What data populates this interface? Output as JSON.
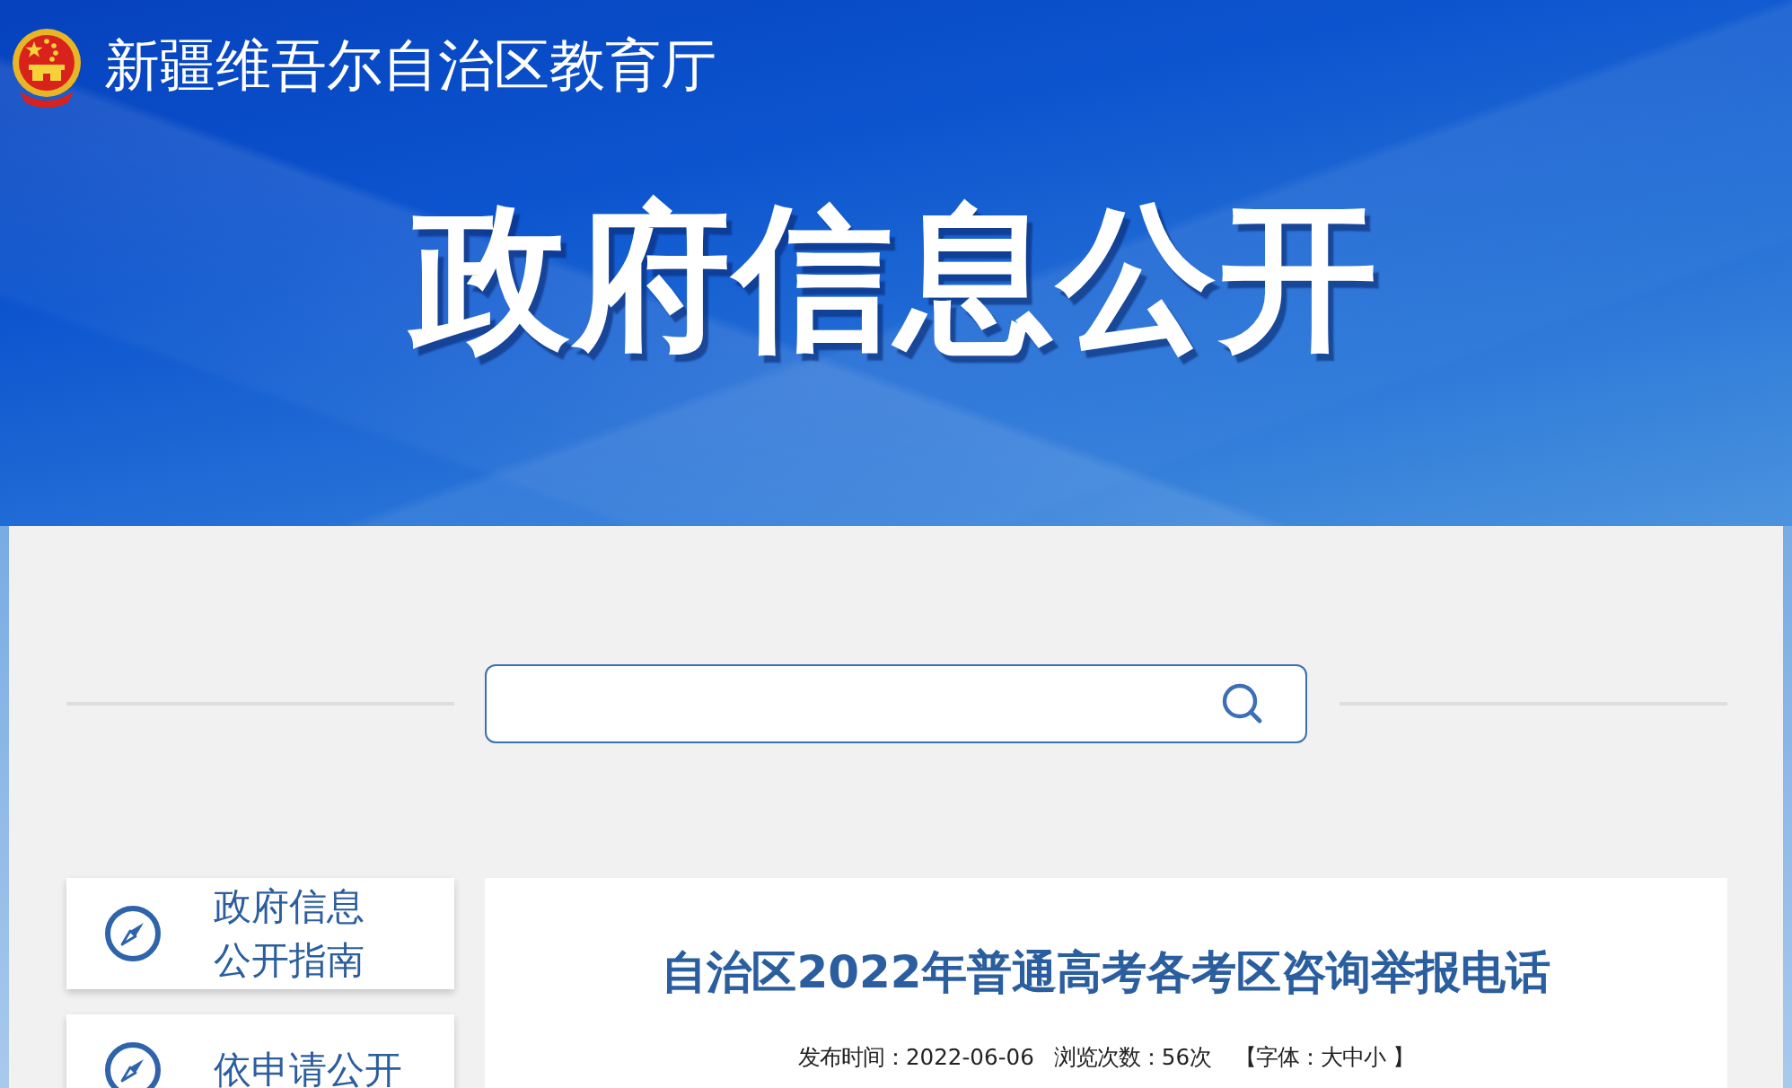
{
  "header": {
    "site_name": "新疆维吾尔自治区教育厅",
    "banner_title": "政府信息公开"
  },
  "sidebar": {
    "items": [
      {
        "label": "政府信息公开指南"
      },
      {
        "label": "依申请公开"
      }
    ]
  },
  "article": {
    "title": "自治区2022年普通高考各考区咨询举报电话",
    "meta": {
      "published": "发布时间：2022-06-06",
      "views": "浏览次数：56次",
      "font_size_label": "【字体：",
      "font_sizes": [
        "大",
        "中",
        "小"
      ],
      "font_size_end": "】"
    }
  }
}
